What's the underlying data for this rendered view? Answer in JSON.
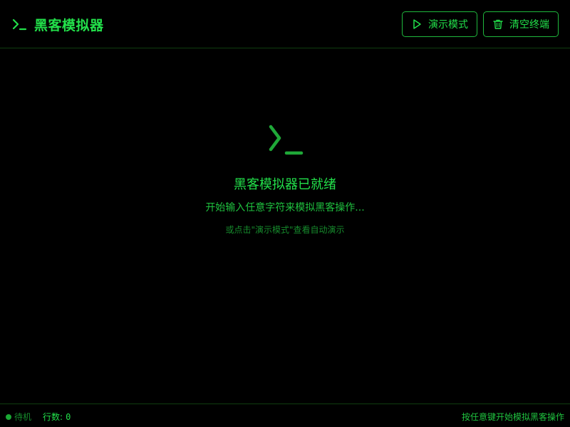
{
  "header": {
    "title": "黑客模拟器",
    "brand_icon": "terminal-prompt-icon",
    "buttons": {
      "demo_label": "演示模式",
      "demo_icon": "play-icon",
      "clear_label": "清空终端",
      "clear_icon": "trash-icon"
    }
  },
  "main": {
    "empty_state": {
      "icon": "terminal-prompt-icon",
      "title": "黑客模拟器已就绪",
      "subtitle": "开始输入任意字符来模拟黑客操作...",
      "hint": "或点击\"演示模式\"查看自动演示"
    }
  },
  "statusbar": {
    "state": "待机",
    "lines_label": "行数:",
    "lines_value": "0",
    "right_hint": "按任意键开始模拟黑客操作"
  },
  "colors": {
    "background": "#000000",
    "accent": "#22e04a",
    "accent_dim": "#168a2c",
    "border": "#0f3d0f"
  }
}
